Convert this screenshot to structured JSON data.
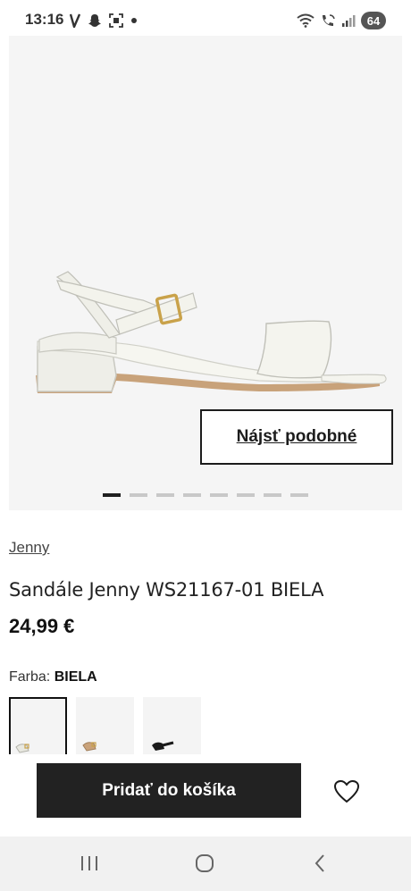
{
  "status_bar": {
    "time": "13:16",
    "battery": "64",
    "left_icons": [
      "v-icon",
      "snapchat-icon",
      "screenshot-icon",
      "dot-icon"
    ],
    "right_icons": [
      "wifi-icon",
      "call-icon",
      "signal-icon",
      "battery-icon"
    ]
  },
  "gallery": {
    "similar_label": "Nájsť podobné",
    "dot_count": 8,
    "active_dot": 0
  },
  "product": {
    "brand": "Jenny",
    "title": "Sandále Jenny WS21167-01 BIELA",
    "price": "24,99 €",
    "color_label": "Farba:",
    "color_value": "BIELA"
  },
  "variants": [
    {
      "name": "white",
      "selected": true
    },
    {
      "name": "beige",
      "selected": false
    },
    {
      "name": "black",
      "selected": false
    }
  ],
  "actions": {
    "cart_label": "Pridať do košíka"
  },
  "colors": {
    "dark": "#222222",
    "image_bg": "#f5f5f5",
    "nav_bg": "#f1f1f1"
  }
}
